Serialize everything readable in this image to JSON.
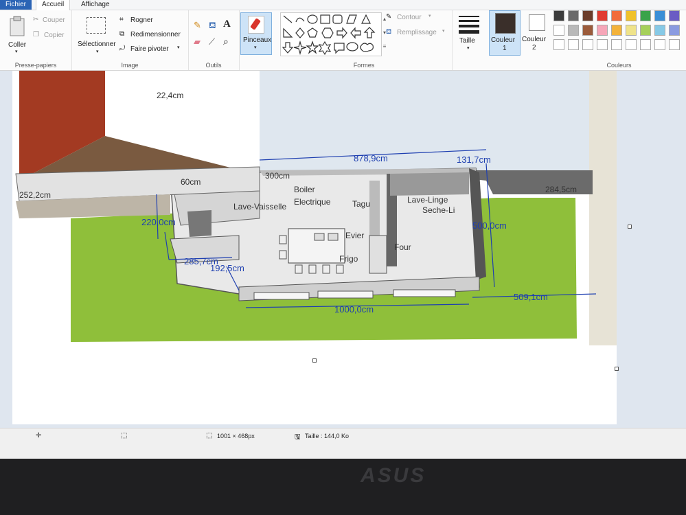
{
  "tabs": [
    "Fichier",
    "Accueil",
    "Affichage"
  ],
  "clipboard": {
    "paste": "Coller",
    "cut": "Couper",
    "copy": "Copier",
    "group": "Presse-papiers"
  },
  "image": {
    "select": "Sélectionner",
    "crop": "Rogner",
    "resize": "Redimensionner",
    "rotate": "Faire pivoter",
    "group": "Image"
  },
  "tools": {
    "group": "Outils",
    "brush": "Pinceaux"
  },
  "shapes": {
    "outline": "Contour",
    "fill": "Remplissage",
    "group": "Formes"
  },
  "size": {
    "label": "Taille"
  },
  "color1": {
    "label": "Couleur",
    "num": "1"
  },
  "color2": {
    "label": "Couleur",
    "num": "2"
  },
  "colors": {
    "group": "Couleurs",
    "row1": [
      "#3c3c3c",
      "#6a6a6a",
      "#6b3d2b",
      "#e03c31",
      "#f26c3a",
      "#f0c22b",
      "#3aa34a",
      "#3b8fd6",
      "#6a5bc4"
    ],
    "row2": [
      "#ffffff",
      "#b9b9b9",
      "#9b5b3b",
      "#f6a6b8",
      "#f3b23a",
      "#efe38a",
      "#a6d05a",
      "#86c9e6",
      "#8a9be0"
    ]
  },
  "plan": {
    "dims": [
      "22,4cm",
      "878,9cm",
      "131,7cm",
      "284,5cm",
      "252,2cm",
      "220,0cm",
      "500,0cm",
      "285,7cm",
      "192,5cm",
      "509,1cm",
      "1000,0cm",
      "300cm",
      "60cm"
    ],
    "rooms": [
      "Boiler",
      "Electrique",
      "Lave-Vaisselle",
      "Tagu",
      "Lave-Linge",
      "Seche-Li",
      "Evier",
      "Four",
      "Frigo"
    ]
  },
  "status": {
    "dimensions": "1001 × 468px",
    "size": "Taille : 144,0 Ko"
  },
  "brand": "ASUS"
}
